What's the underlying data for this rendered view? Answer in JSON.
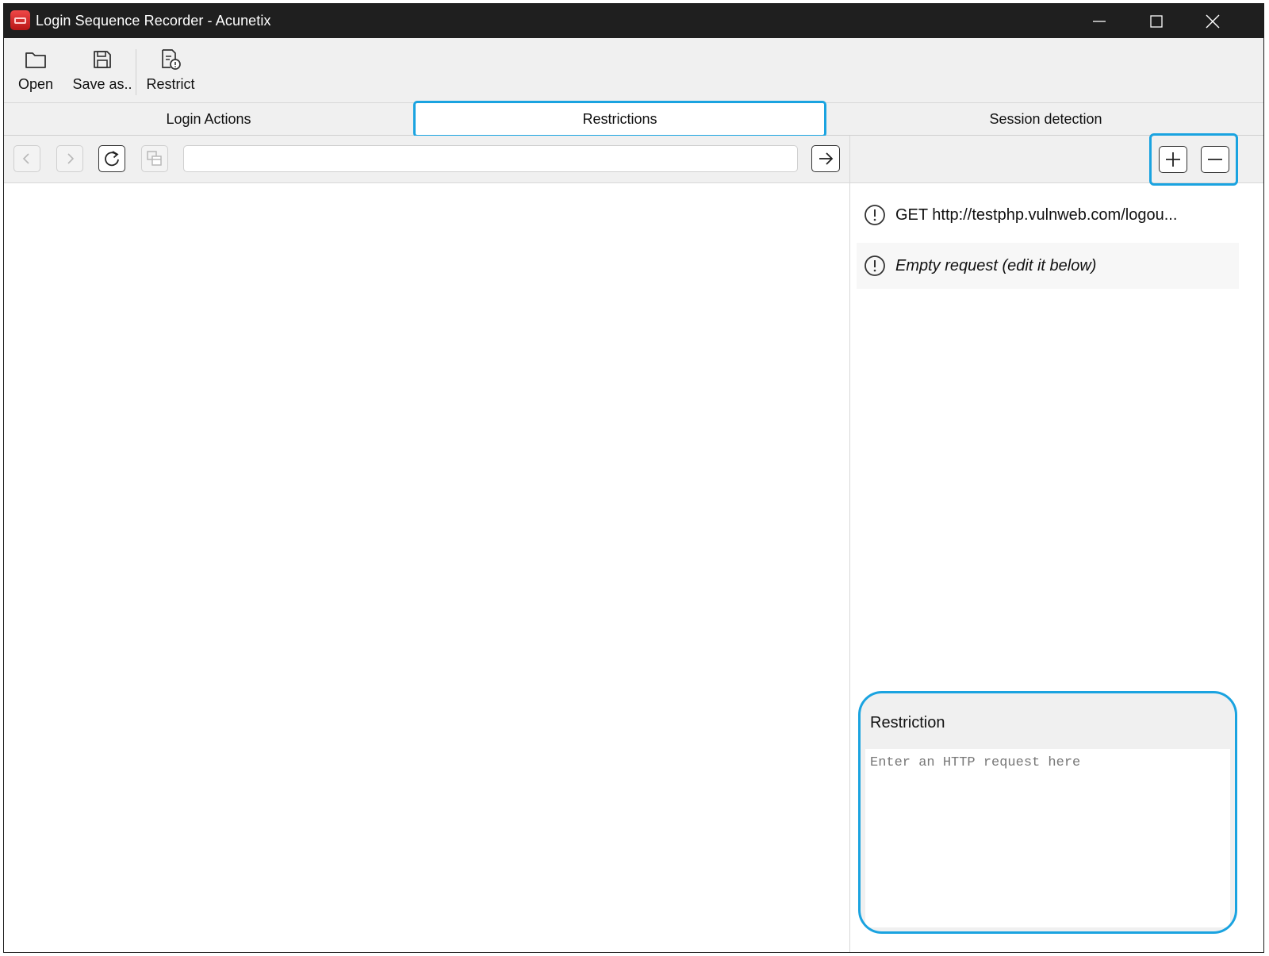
{
  "window": {
    "title": "Login Sequence Recorder - Acunetix"
  },
  "toolbar": {
    "open_label": "Open",
    "save_label": "Save as..",
    "restrict_label": "Restrict"
  },
  "tabs": [
    {
      "label": "Login Actions",
      "active": false
    },
    {
      "label": "Restrictions",
      "active": true
    },
    {
      "label": "Session detection",
      "active": false
    }
  ],
  "browser": {
    "url_value": ""
  },
  "requests": [
    {
      "text": "GET http://testphp.vulnweb.com/logou...",
      "italic": false
    },
    {
      "text": "Empty request (edit it below)",
      "italic": true
    }
  ],
  "restriction": {
    "title": "Restriction",
    "placeholder": "Enter an HTTP request here"
  },
  "colors": {
    "highlight": "#1aa3e0",
    "titlebar": "#1f1f1f"
  }
}
